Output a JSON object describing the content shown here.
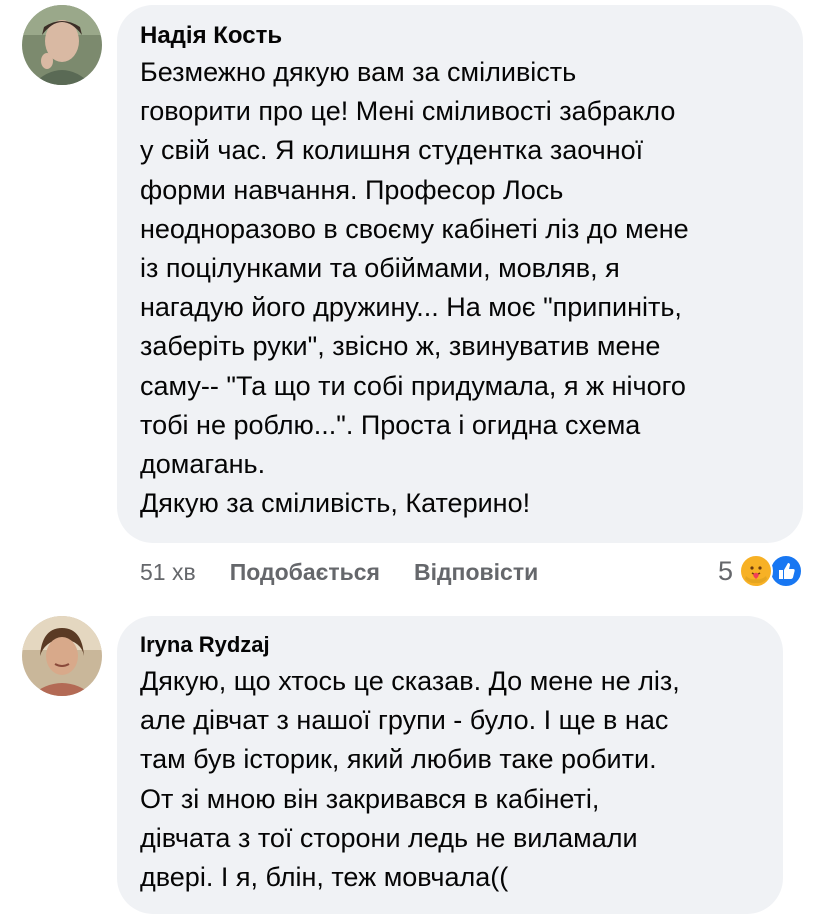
{
  "comments": [
    {
      "author": "Надія Кость",
      "lines": [
        "Безмежно дякую вам за сміливість",
        "говорити про це! Мені сміливості забракло",
        "у свій час. Я колишня студентка заочної",
        "форми навчання. Професор Лось",
        "неодноразово в своєму кабінеті ліз до мене",
        "із поцілунками та обіймами, мовляв, я",
        "нагадую його дружину... На моє \"припиніть,",
        "заберіть руки\", звісно ж, звинуватив мене",
        "саму-- \"Та що ти собі придумала, я ж нічого",
        "тобі не роблю...\". Проста і огидна схема",
        "домагань.",
        "Дякую за сміливість, Катерино!"
      ],
      "time": "51 хв",
      "like_label": "Подобається",
      "reply_label": "Відповісти",
      "reaction_count": "5",
      "reaction_icons": [
        "care-reaction-icon",
        "like-reaction-icon"
      ]
    },
    {
      "author": "Iryna Rydzaj",
      "lines": [
        "Дякую, що хтось це сказав. До мене не ліз,",
        "але дівчат з нашої групи - було. І ще в нас",
        "там був історик, який любив таке робити.",
        "От зі мною він закривався в кабінеті,",
        "дівчата з тої сторони ледь не виламали",
        "двері. І я, блін, теж мовчала(("
      ]
    }
  ],
  "colors": {
    "bubble": "#f0f2f5",
    "text": "#050505",
    "secondary": "#65676b",
    "like_blue": "#1877f2",
    "care_yellow": "#f7b125"
  }
}
